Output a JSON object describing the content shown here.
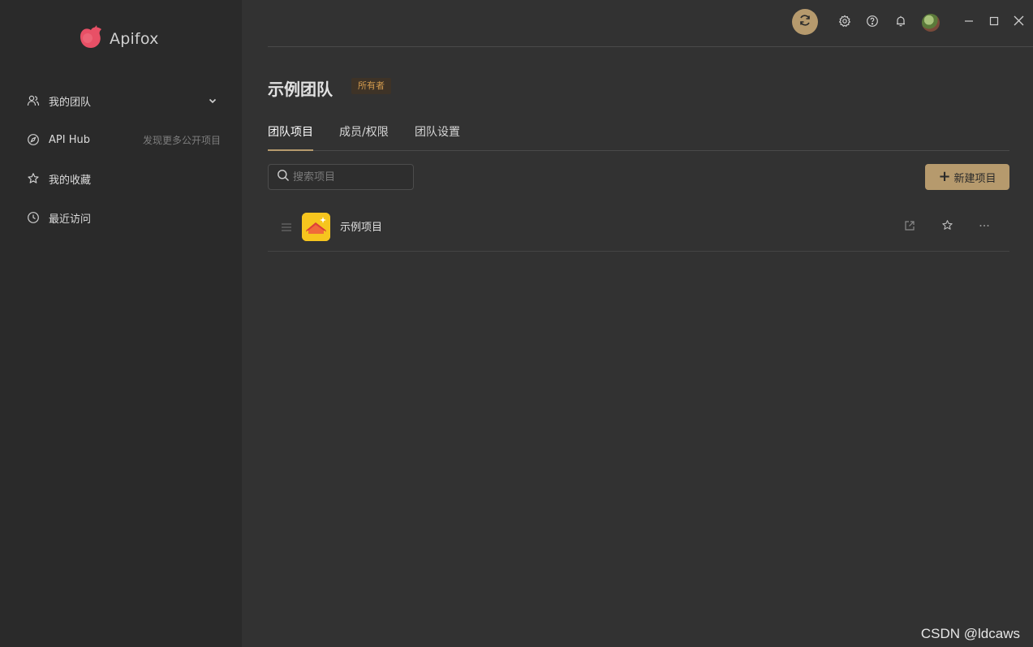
{
  "brand": {
    "name": "Apifox"
  },
  "sidebar": {
    "items": [
      {
        "label": "我的团队",
        "icon": "team-icon"
      },
      {
        "label": "API Hub",
        "icon": "compass-icon",
        "hint": "发现更多公开项目"
      },
      {
        "label": "我的收藏",
        "icon": "star-icon"
      },
      {
        "label": "最近访问",
        "icon": "clock-icon"
      }
    ]
  },
  "team": {
    "title": "示例团队",
    "role_badge": "所有者"
  },
  "tabs": [
    {
      "label": "团队项目",
      "active": true
    },
    {
      "label": "成员/权限",
      "active": false
    },
    {
      "label": "团队设置",
      "active": false
    }
  ],
  "search": {
    "placeholder": "搜索项目",
    "value": ""
  },
  "toolbar": {
    "new_project_label": "新建项目"
  },
  "projects": [
    {
      "name": "示例项目"
    }
  ],
  "watermark": "CSDN @ldcaws",
  "colors": {
    "accent": "#b69a6d",
    "sidebar_bg": "#2a2a2a",
    "main_bg": "#323232",
    "badge_text": "#d19a4e"
  }
}
